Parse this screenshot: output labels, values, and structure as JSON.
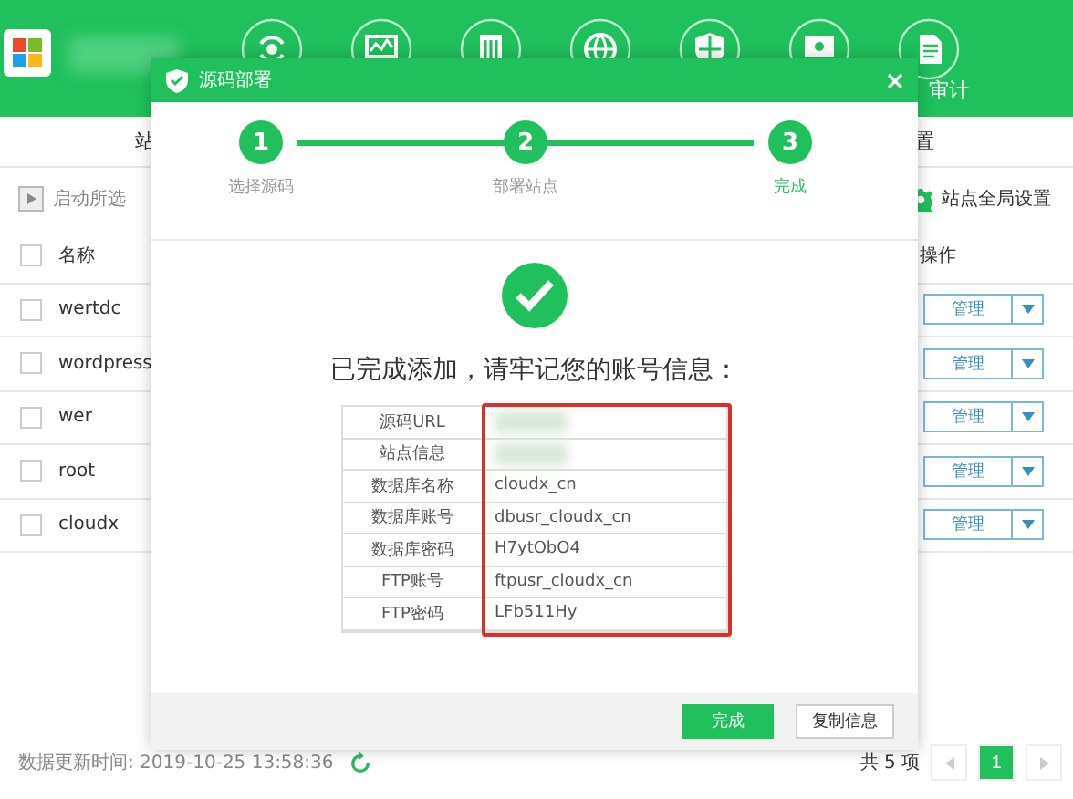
{
  "header": {
    "nav_label": "审计"
  },
  "tabs": [
    {
      "label": "站"
    },
    {
      "label": "置"
    }
  ],
  "toolbar": {
    "start_selected": "启动所选",
    "global_settings": "站点全局设置"
  },
  "table": {
    "all_checked": false,
    "columns": [
      "名称",
      "操作"
    ],
    "rows": [
      {
        "name": "wertdc",
        "checked": false,
        "action": "管理"
      },
      {
        "name": "wordpress",
        "checked": false,
        "action": "管理"
      },
      {
        "name": "wer",
        "checked": false,
        "action": "管理"
      },
      {
        "name": "root",
        "checked": false,
        "action": "管理"
      },
      {
        "name": "cloudx",
        "checked": false,
        "action": "管理"
      }
    ]
  },
  "footer": {
    "updated": "数据更新时间: 2019-10-25 13:58:36",
    "total": "共 5 项",
    "page": "1"
  },
  "dialog": {
    "title": "源码部署",
    "steps": [
      {
        "number": "1",
        "label": "选择源码",
        "selected": false
      },
      {
        "number": "2",
        "label": "部署站点",
        "selected": false
      },
      {
        "number": "3",
        "label": "完成",
        "selected": true
      }
    ],
    "message": "已完成添加，请牢记您的账号信息：",
    "info": [
      {
        "label": "源码URL"
      },
      {
        "label": "站点信息"
      },
      {
        "label": "数据库名称",
        "value": "cloudx_cn"
      },
      {
        "label": "数据库账号",
        "value": "dbusr_cloudx_cn"
      },
      {
        "label": "数据库密码",
        "value": "H7ytObO4"
      },
      {
        "label": "FTP账号",
        "value": "ftpusr_cloudx_cn"
      },
      {
        "label": "FTP密码",
        "value": "LFb511Hy"
      }
    ],
    "buttons": [
      {
        "label": "完成",
        "kind": "primary"
      },
      {
        "label": "复制信息",
        "kind": "secondary"
      }
    ]
  }
}
